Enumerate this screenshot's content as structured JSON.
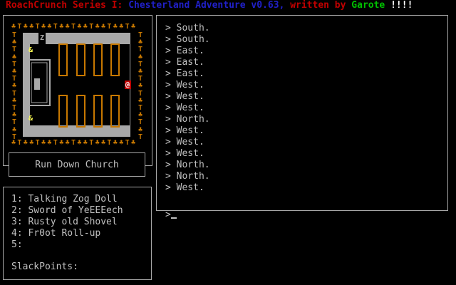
{
  "title": {
    "series": "RoachCrunch Series I:",
    "name": "Chesterland Adventure v0.63,",
    "written_by": "written by",
    "author": "Garote",
    "bangs": "!!!!"
  },
  "location": "Run Down Church",
  "map": {
    "tree_glyph": "♣",
    "alt_tree_glyph": "T",
    "door_label": "Z",
    "npc_glyph": "&",
    "player_glyph": "@",
    "tree_color": "#c87800",
    "wall_color": "#a8a8a8",
    "floor_color": "#000000",
    "pew_color": "#c87800",
    "npc_color": "#ffff55",
    "player_color": "#ff5555"
  },
  "log": [
    "South.",
    "South.",
    "East.",
    "East.",
    "East.",
    "West.",
    "West.",
    "West.",
    "North.",
    "West.",
    "West.",
    "West.",
    "North.",
    "North.",
    "West."
  ],
  "prompt_char": ">",
  "inventory": {
    "items": [
      "Talking Zog Doll",
      "Sword of YeEEEech",
      "Rusty old Shovel",
      "Fr0ot Roll-up",
      ""
    ],
    "slack_label": "SlackPoints:",
    "slack_value": ""
  }
}
